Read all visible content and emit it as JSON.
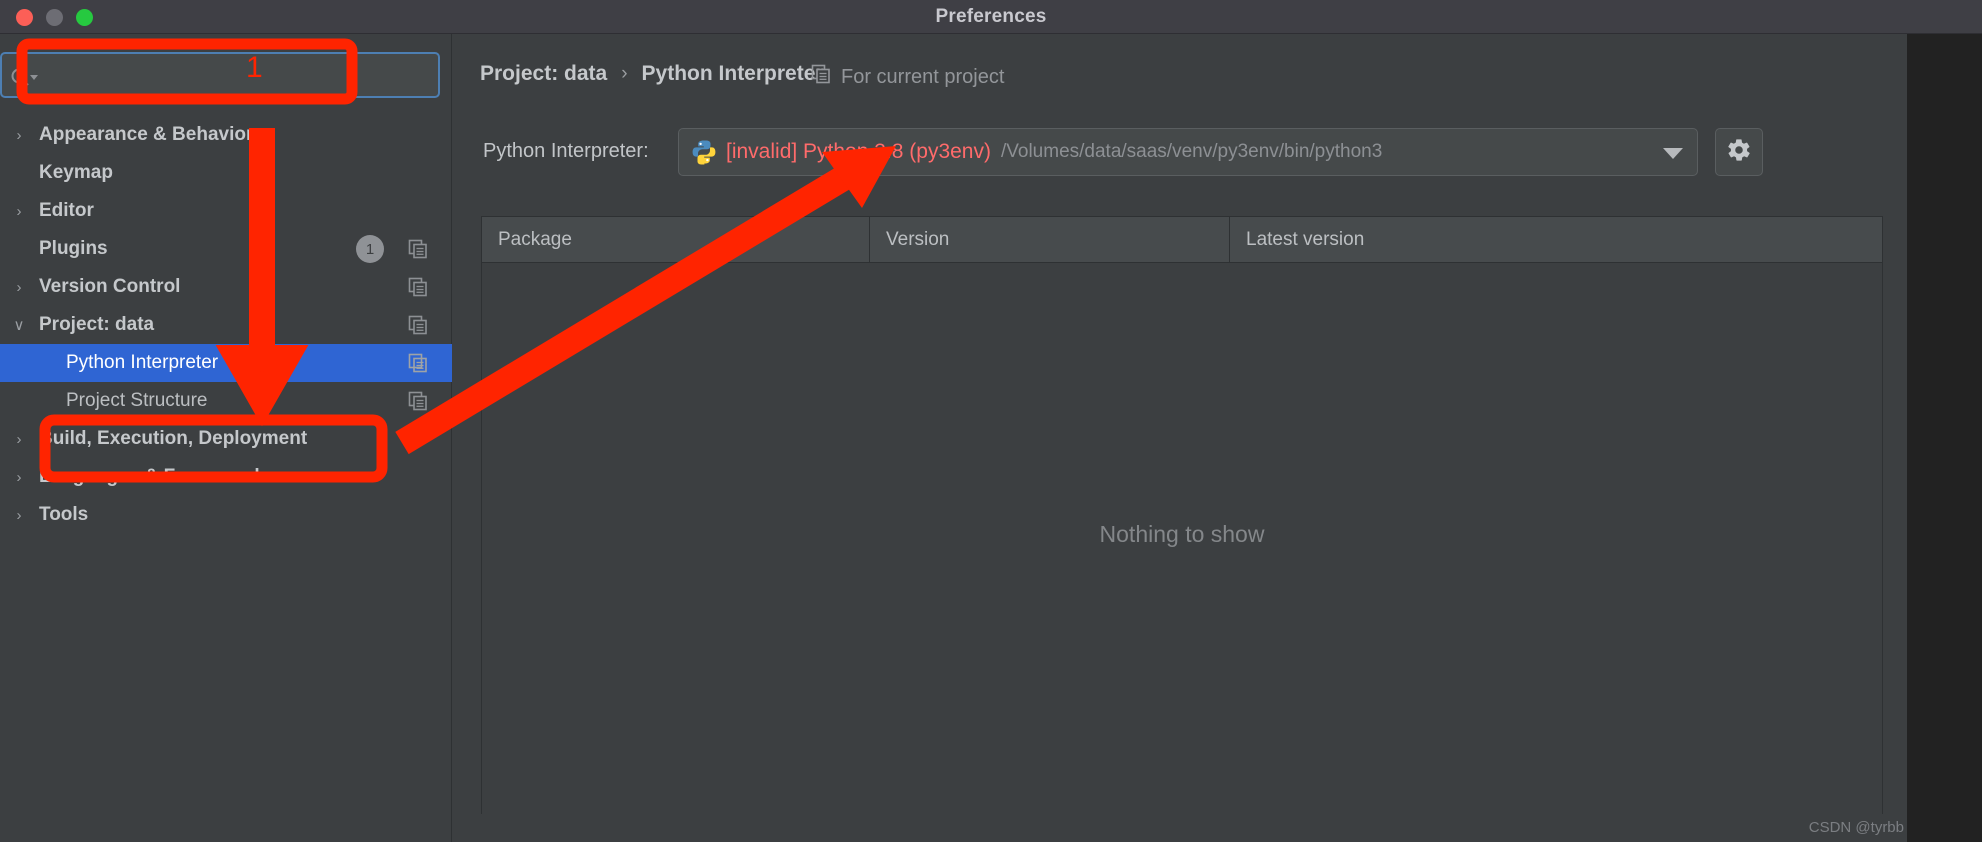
{
  "window": {
    "title": "Preferences",
    "traffic_lights": [
      "close-red",
      "minimize-gray",
      "zoom-green"
    ]
  },
  "search": {
    "value": "",
    "placeholder": "",
    "icon": "search-icon"
  },
  "sidebar": {
    "items": [
      {
        "label": "Appearance & Behavior",
        "level": "top",
        "twisty": "›",
        "expanded": false,
        "badge": null,
        "copy_icon": false,
        "selected": false
      },
      {
        "label": "Keymap",
        "level": "top",
        "twisty": "",
        "expanded": false,
        "badge": null,
        "copy_icon": false,
        "selected": false
      },
      {
        "label": "Editor",
        "level": "top",
        "twisty": "›",
        "expanded": false,
        "badge": null,
        "copy_icon": false,
        "selected": false
      },
      {
        "label": "Plugins",
        "level": "top",
        "twisty": "",
        "expanded": false,
        "badge": "1",
        "copy_icon": true,
        "selected": false
      },
      {
        "label": "Version Control",
        "level": "top",
        "twisty": "›",
        "expanded": false,
        "badge": null,
        "copy_icon": true,
        "selected": false
      },
      {
        "label": "Project: data",
        "level": "top",
        "twisty": "∨",
        "expanded": true,
        "badge": null,
        "copy_icon": true,
        "selected": false
      },
      {
        "label": "Python Interpreter",
        "level": "child",
        "twisty": "",
        "expanded": false,
        "badge": null,
        "copy_icon": true,
        "selected": true
      },
      {
        "label": "Project Structure",
        "level": "child",
        "twisty": "",
        "expanded": false,
        "badge": null,
        "copy_icon": true,
        "selected": false
      },
      {
        "label": "Build, Execution, Deployment",
        "level": "top",
        "twisty": "›",
        "expanded": false,
        "badge": null,
        "copy_icon": false,
        "selected": false
      },
      {
        "label": "Languages & Frameworks",
        "level": "top",
        "twisty": "›",
        "expanded": false,
        "badge": null,
        "copy_icon": false,
        "selected": false
      },
      {
        "label": "Tools",
        "level": "top",
        "twisty": "›",
        "expanded": false,
        "badge": null,
        "copy_icon": false,
        "selected": false
      }
    ]
  },
  "header": {
    "breadcrumb": [
      "Project: data",
      "Python Interpreter"
    ],
    "separator": "›",
    "for_current_project": "For current project",
    "for_current_project_icon": "copy-icon"
  },
  "interpreter": {
    "label": "Python Interpreter:",
    "icon": "python-logo-icon",
    "name": "[invalid] Python 3.8 (py3env)",
    "path": "/Volumes/data/saas/venv/py3env/bin/python3",
    "dropdown_icon": "chevron-down-icon",
    "settings_icon": "gear-icon"
  },
  "packages": {
    "columns": [
      "Package",
      "Version",
      "Latest version"
    ],
    "rows": [],
    "empty_text": "Nothing to show"
  },
  "annotations": {
    "step_1": "1",
    "accent_color": "#ff2400"
  },
  "watermark": "CSDN @tyrbb",
  "colors": {
    "window_bg": "#3c3f41",
    "titlebar_bg": "#3f3f45",
    "selection_blue": "#2f65d3",
    "search_focus_border": "#4d7fb3",
    "invalid_red": "#ff6b6b",
    "annotation_red": "#ff2400",
    "right_gutter": "#222222"
  }
}
